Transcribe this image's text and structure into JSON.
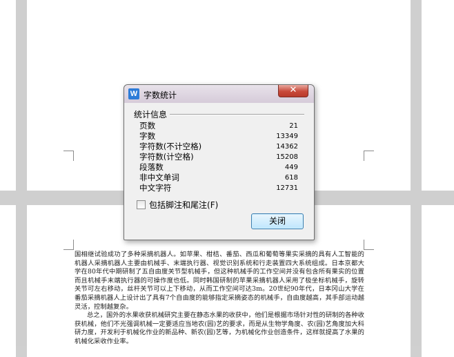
{
  "dialog": {
    "title": "字数统计",
    "app_icon_letter": "W",
    "close_glyph": "✕",
    "group_title": "统计信息",
    "stats": [
      {
        "label": "页数",
        "value": "21"
      },
      {
        "label": "字数",
        "value": "13349"
      },
      {
        "label": "字符数(不计空格)",
        "value": "14362"
      },
      {
        "label": "字符数(计空格)",
        "value": "15208"
      },
      {
        "label": "段落数",
        "value": "449"
      },
      {
        "label": "非中文单词",
        "value": "618"
      },
      {
        "label": "中文字符",
        "value": "12731"
      }
    ],
    "checkbox_label": "包括脚注和尾注",
    "checkbox_hotkey": "(F)",
    "checkbox_checked": false,
    "close_button_label": "关闭"
  },
  "document": {
    "paragraphs": [
      "国相继试验成功了多种采摘机器人。如苹果、柑桔、番茄、西瓜和葡萄等果实采摘的具有人工智能的机器人采摘机器人主要由机械手、末端执行器、视觉识别系统和行走装置四大系统组成。日本京都大学在80年代中期研制了五自由度关节型机械手，但这种机械手的工作空间并没有包含所有果实的位置而且机械手末端执行器的可操作度也低。同时韩国研制的苹果采摘机器人采用了极坐标机械手，旋转关节可左右移动，丝杆关节可以上下移动，从而工作空间可达3m。20世纪90年代，日本冈山大学在番茄采摘机器人上设计出了具有7个自由度的能够指定采摘姿态的机械手，自由度越高，其手部运动越灵活，控制越复杂。",
      "总之，国外的水果收获机械研究主要在静态水果的收获中，他们是根据市场针对性的研制的各种收获机械，他们不光强调机械一定要适应当地农(园)艺的要求，而是从生物学角度、农(园)艺角度加大科研力度，开发利于机械化作业的新品种、新农(园)艺等，为机械化作业创造条件，这样就提高了水果的机械化采收作业率。"
    ]
  }
}
